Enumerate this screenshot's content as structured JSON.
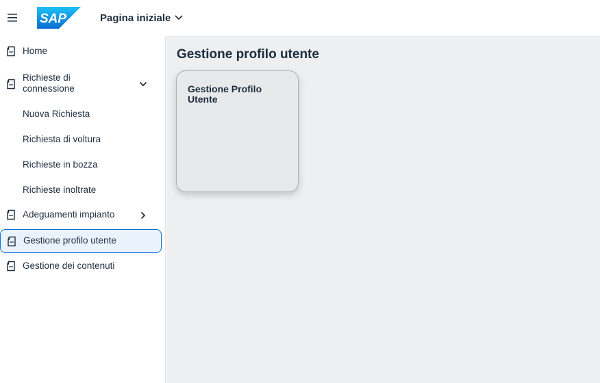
{
  "shell": {
    "logo_text": "SAP",
    "page_title": "Pagina iniziale",
    "brand_color": "#0a6ed1"
  },
  "sidebar": {
    "items": [
      {
        "label": "Home",
        "icon": "document-icon"
      },
      {
        "label": "Richieste di connessione",
        "label_line1": "Richieste di",
        "label_line2": "connessione",
        "icon": "document-icon",
        "expanded": true
      },
      {
        "label": "Nuova Richiesta"
      },
      {
        "label": "Richiesta di voltura"
      },
      {
        "label": "Richieste in bozza"
      },
      {
        "label": "Richieste inoltrate"
      },
      {
        "label": "Adeguamenti impianto",
        "icon": "document-icon",
        "expanded": false
      },
      {
        "label": "Gestione profilo utente",
        "icon": "document-icon",
        "selected": true
      },
      {
        "label": "Gestione dei contenuti",
        "icon": "document-icon"
      }
    ]
  },
  "main": {
    "title": "Gestione profilo utente",
    "tiles": [
      {
        "title": "Gestione Profilo Utente"
      }
    ]
  }
}
